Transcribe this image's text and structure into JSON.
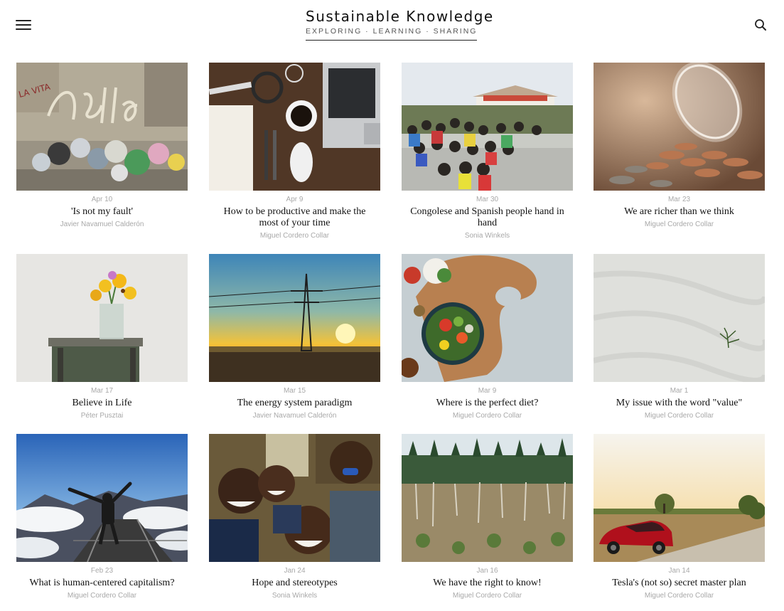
{
  "site": {
    "title": "Sustainable Knowledge",
    "tagline": "EXPLORING · LEARNING · SHARING"
  },
  "header": {
    "menu_icon": "hamburger-menu-icon",
    "search_icon": "search-icon"
  },
  "posts": [
    {
      "date": "Apr 10",
      "title": "'Is not my fault'",
      "author": "Javier Navamuel Calderón",
      "image": "graffiti wall with garbage bags"
    },
    {
      "date": "Apr 9",
      "title": "How to be productive and make the most of your time",
      "author": "Miguel Cordero Collar",
      "image": "desk with laptop and coffee"
    },
    {
      "date": "Mar 30",
      "title": "Congolese and Spanish people hand in hand",
      "author": "Sonia Winkels",
      "image": "crowd of children seated outdoors"
    },
    {
      "date": "Mar 23",
      "title": "We are richer than we think",
      "author": "Miguel Cordero Collar",
      "image": "coins spilling from jar"
    },
    {
      "date": "Mar 17",
      "title": "Believe in Life",
      "author": "Péter Pusztai",
      "image": "flowers in jar on stool"
    },
    {
      "date": "Mar 15",
      "title": "The energy system paradigm",
      "author": "Javier Navamuel Calderón",
      "image": "power pylon at sunset"
    },
    {
      "date": "Mar 9",
      "title": "Where is the perfect diet?",
      "author": "Miguel Cordero Collar",
      "image": "salad bowl on cutting board"
    },
    {
      "date": "Mar 1",
      "title": "My issue with the word \"value\"",
      "author": "Miguel Cordero Collar",
      "image": "small plant in sand"
    },
    {
      "date": "Feb 23",
      "title": "What is human-centered capitalism?",
      "author": "Miguel Cordero Collar",
      "image": "person on bridge above clouds"
    },
    {
      "date": "Jan 24",
      "title": "Hope and stereotypes",
      "author": "Sonia Winkels",
      "image": "smiling children"
    },
    {
      "date": "Jan 16",
      "title": "We have the right to know!",
      "author": "Miguel Cordero Collar",
      "image": "logged forest"
    },
    {
      "date": "Jan 14",
      "title": "Tesla's (not so) secret master plan",
      "author": "Miguel Cordero Collar",
      "image": "red car at sunset"
    }
  ]
}
